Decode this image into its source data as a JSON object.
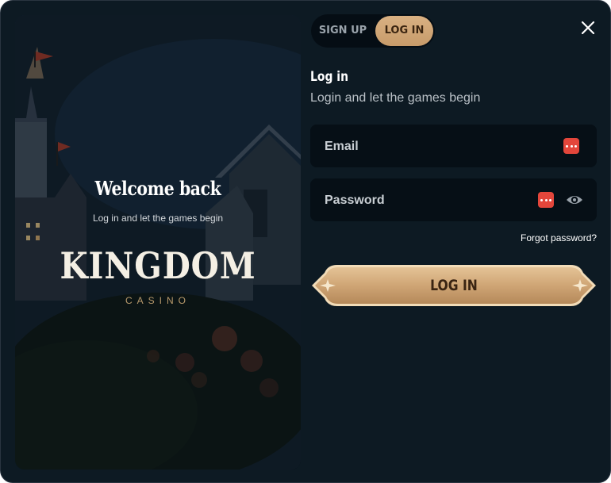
{
  "hero": {
    "title": "Welcome back",
    "subtitle": "Log in and let the games begin",
    "logo_text": "KINGDOM",
    "logo_sub": "CASINO"
  },
  "tabs": [
    {
      "label": "SIGN UP",
      "active": false
    },
    {
      "label": "LOG IN",
      "active": true
    }
  ],
  "form": {
    "title": "Log in",
    "subtitle": "Login and let the games begin",
    "email": {
      "placeholder": "Email",
      "value": ""
    },
    "password": {
      "placeholder": "Password",
      "value": ""
    },
    "forgot_label": "Forgot password?",
    "submit_label": "LOG IN"
  },
  "icons": {
    "close": "close-icon",
    "password_manager": "password-manager-icon",
    "visibility": "eye-icon"
  },
  "colors": {
    "background": "#0d1a23",
    "accent": "#c9a070",
    "field_bg": "#060f16",
    "pm_icon": "#e3463b"
  }
}
